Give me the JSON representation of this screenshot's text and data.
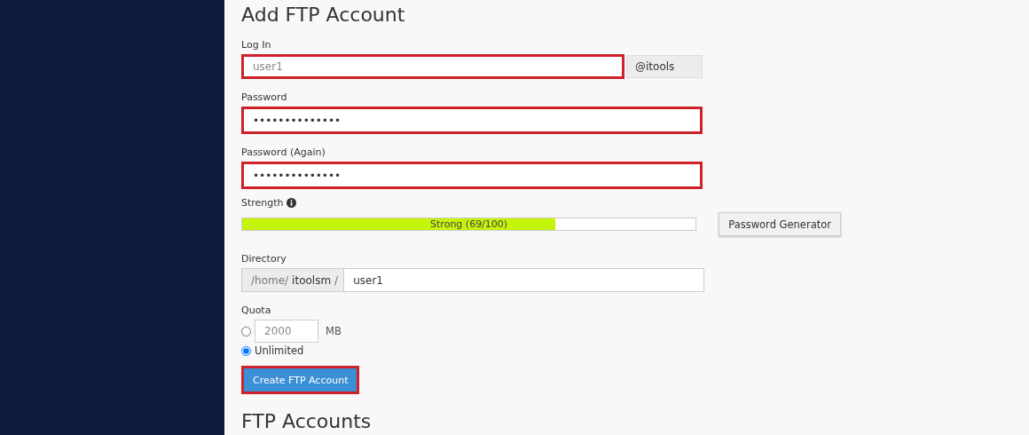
{
  "heading": "Add FTP Account",
  "login": {
    "label": "Log In",
    "placeholder": "user1",
    "highlighted": true,
    "domain": "@itools"
  },
  "password": {
    "label": "Password",
    "value": "••••••••••••••",
    "highlighted": true
  },
  "password_again": {
    "label": "Password (Again)",
    "value": "••••••••••••••",
    "highlighted": true
  },
  "strength": {
    "label": "Strength",
    "level": 0.69,
    "reading": "Strong (69/100)",
    "generator_button": "Password Generator"
  },
  "directory": {
    "label": "Directory",
    "prefix": "/home/",
    "user": "itoolsm",
    "separator": "/",
    "value": "user1"
  },
  "quota": {
    "label": "Quota",
    "options": [
      {
        "kind": "amount",
        "placeholder": "2000",
        "unit": "MB",
        "selected": false
      },
      {
        "kind": "text",
        "label": "Unlimited",
        "selected": true
      }
    ]
  },
  "submit": {
    "label": "Create FTP Account",
    "highlighted": true
  },
  "next_heading": "FTP Accounts"
}
